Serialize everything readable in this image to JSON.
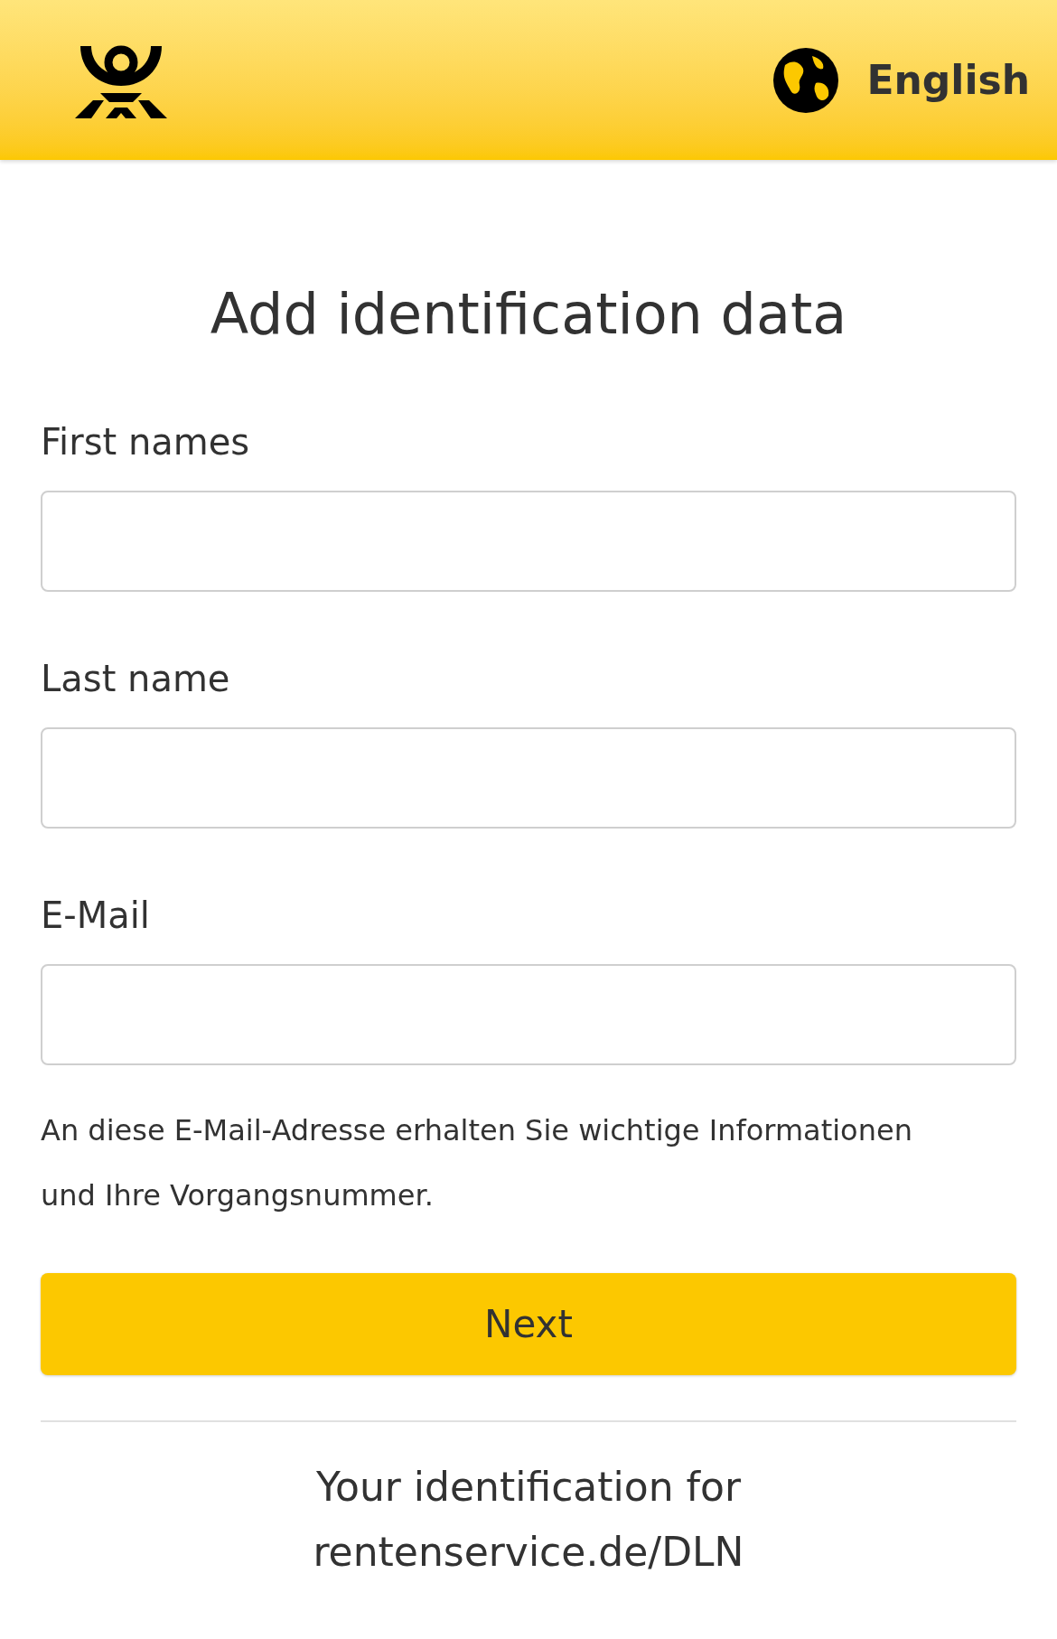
{
  "header": {
    "language": "English"
  },
  "title": "Add identification data",
  "fields": [
    {
      "label": "First names"
    },
    {
      "label": "Last name"
    },
    {
      "label": "E-Mail"
    }
  ],
  "hint": "An diese E-Mail-Adresse erhalten Sie wichtige Informationen und Ihre Vorgangsnummer.",
  "next_button": "Next",
  "footer": [
    "Your identification for",
    "rentenservice.de/DLN"
  ]
}
